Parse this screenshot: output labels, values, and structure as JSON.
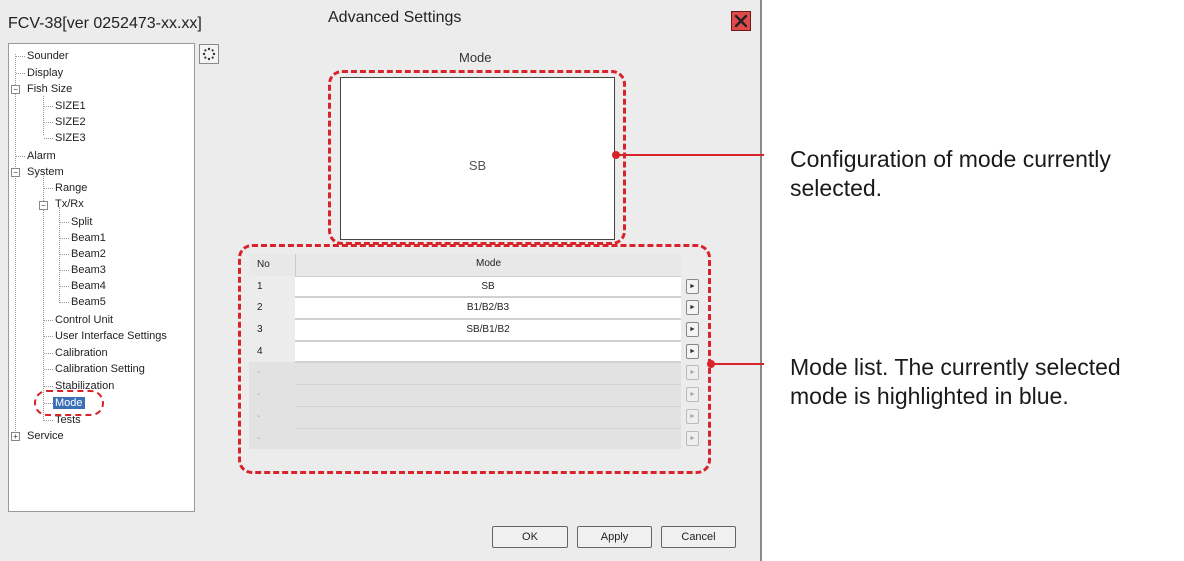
{
  "window": {
    "version_label": "FCV-38[ver 0252473-xx.xx]",
    "title": "Advanced Settings",
    "close_icon": "close-icon"
  },
  "tree": {
    "items": [
      {
        "label": "Sounder"
      },
      {
        "label": "Display"
      },
      {
        "label": "Fish Size",
        "expander": "⊟"
      },
      {
        "label": "SIZE1"
      },
      {
        "label": "SIZE2"
      },
      {
        "label": "SIZE3"
      },
      {
        "label": "Alarm"
      },
      {
        "label": "System",
        "expander": "⊟"
      },
      {
        "label": "Range"
      },
      {
        "label": "Tx/Rx",
        "expander": "⊟"
      },
      {
        "label": "Split"
      },
      {
        "label": "Beam1"
      },
      {
        "label": "Beam2"
      },
      {
        "label": "Beam3"
      },
      {
        "label": "Beam4"
      },
      {
        "label": "Beam5"
      },
      {
        "label": "Control Unit"
      },
      {
        "label": "User Interface Settings"
      },
      {
        "label": "Calibration"
      },
      {
        "label": "Calibration Setting"
      },
      {
        "label": "Stabilization"
      },
      {
        "label": "Mode",
        "selected": true
      },
      {
        "label": "Tests"
      },
      {
        "label": "Service",
        "expander": "⊞"
      }
    ],
    "collapse_icon": "collapse-tree-icon"
  },
  "main": {
    "mode_label": "Mode",
    "preview_text": "SB"
  },
  "table": {
    "headers": {
      "no": "No",
      "mode": "Mode"
    },
    "rows": [
      {
        "no": "1",
        "mode": "SB"
      },
      {
        "no": "2",
        "mode": "B1/B2/B3"
      },
      {
        "no": "3",
        "mode": "SB/B1/B2"
      },
      {
        "no": "4",
        "mode": ""
      },
      {
        "no": "-",
        "mode": ""
      },
      {
        "no": "-",
        "mode": ""
      },
      {
        "no": "-",
        "mode": ""
      },
      {
        "no": "-",
        "mode": ""
      }
    ],
    "row_button_glyph": "►"
  },
  "buttons": {
    "ok": "OK",
    "apply": "Apply",
    "cancel": "Cancel"
  },
  "callouts": {
    "config": [
      "Configuration of mode currently",
      "selected."
    ],
    "list": [
      "Mode list. The currently selected",
      "mode is highlighted in blue."
    ]
  },
  "colors": {
    "highlight_red": "#d8232a",
    "selected_blue": "#3b6fb6",
    "close_red": "#e04a4a"
  }
}
